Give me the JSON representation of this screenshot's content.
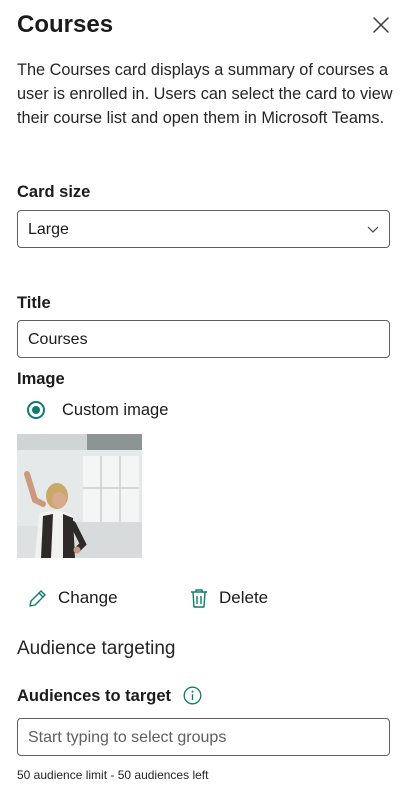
{
  "panel": {
    "title": "Courses",
    "close_icon": "close-icon",
    "description": "The Courses card displays a summary of courses a user is enrolled in. Users can select the card to view their course list and open them in Microsoft Teams."
  },
  "card_size": {
    "label": "Card size",
    "value": "Large",
    "icon": "chevron-down-icon"
  },
  "title_field": {
    "label": "Title",
    "value": "Courses"
  },
  "image": {
    "label": "Image",
    "option_label": "Custom image",
    "option_selected": true,
    "change_label": "Change",
    "change_icon": "pencil-icon",
    "delete_label": "Delete",
    "delete_icon": "trash-icon"
  },
  "audience": {
    "heading": "Audience targeting",
    "label": "Audiences to target",
    "info_icon": "info-icon",
    "placeholder": "Start typing to select groups",
    "footnote": "50 audience limit - 50 audiences left"
  },
  "colors": {
    "accent": "#0f7d6d",
    "text": "#1b1b1b",
    "border": "#5f5f5f"
  }
}
